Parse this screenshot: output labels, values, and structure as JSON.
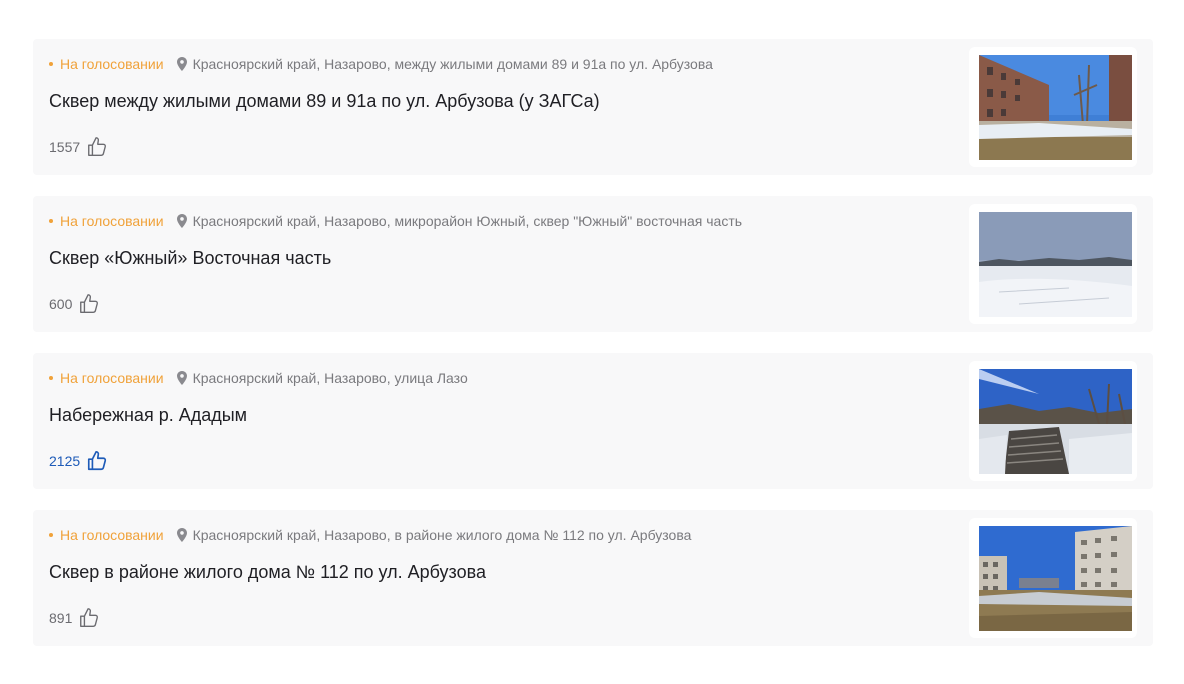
{
  "colors": {
    "status": "#f0a23a",
    "address": "#7a7a7e",
    "liked": "#1e5bb8",
    "card_bg": "#f8f8f9"
  },
  "icons": {
    "location": "map-pin-icon",
    "like": "thumbs-up-icon"
  },
  "projects": [
    {
      "status": "На голосовании",
      "address": "Красноярский край, Назарово, между жилыми домами 89 и 91а по ул. Арбузова",
      "title": "Сквер между жилыми домами 89 и 91а по ул. Арбузова (у ЗАГСа)",
      "likes": "1557",
      "liked": false
    },
    {
      "status": "На голосовании",
      "address": "Красноярский край, Назарово, микрорайон Южный, сквер \"Южный\" восточная часть",
      "title": "Сквер «Южный» Восточная часть",
      "likes": "600",
      "liked": false
    },
    {
      "status": "На голосовании",
      "address": "Красноярский край, Назарово, улица Лазо",
      "title": "Набережная р. Ададым",
      "likes": "2125",
      "liked": true
    },
    {
      "status": "На голосовании",
      "address": "Красноярский край, Назарово, в районе жилого дома № 112 по ул. Арбузова",
      "title": "Сквер в районе жилого дома № 112 по ул. Арбузова",
      "likes": "891",
      "liked": false
    }
  ]
}
